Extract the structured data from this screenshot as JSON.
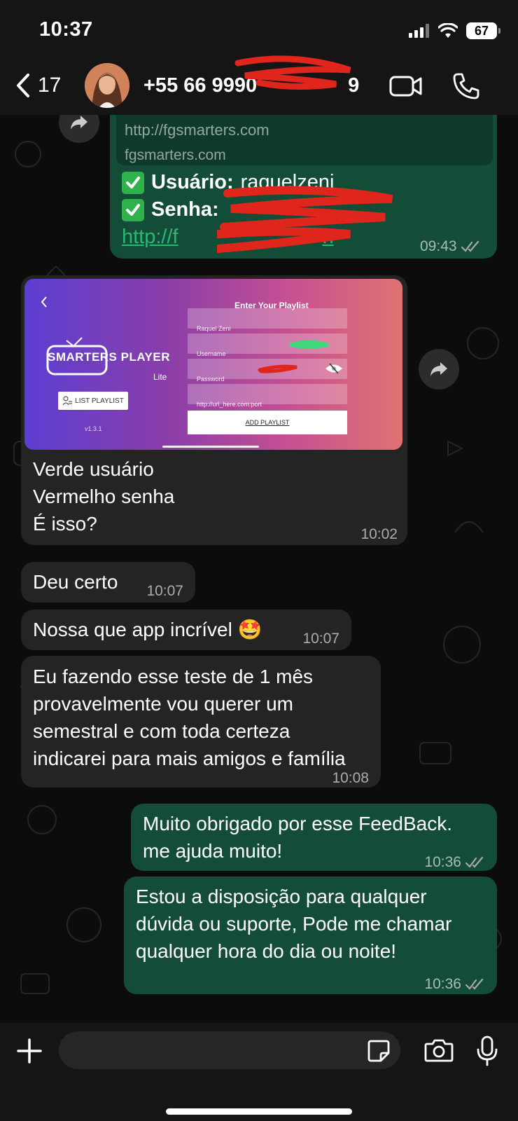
{
  "status_bar": {
    "time": "10:37",
    "battery": "67"
  },
  "header": {
    "back_count": "17",
    "contact_name": "+55 66 9990",
    "contact_suffix": "9"
  },
  "messages": {
    "m1": {
      "link_url": "http://fgsmarters.com",
      "link_domain": "fgsmarters.com",
      "user_label": "Usuário:",
      "user_value": "raquelzeni",
      "password_label": "Senha:",
      "link_text": "http://f",
      "link_tail": "n",
      "time": "09:43"
    },
    "m2": {
      "image": {
        "logo": "SMARTERS PLAYER",
        "logo_sub": "Lite",
        "list_button": "LIST PLAYLIST",
        "version": "v1.3.1",
        "title": "Enter Your Playlist",
        "field_name": "Raquel Zeni",
        "field_username": "Username",
        "field_password": "Password",
        "field_url": "http://url_here.com:port",
        "add_button": "ADD PLAYLIST"
      },
      "text": "Verde usuário\nVermelho senha\nÉ isso?",
      "time": "10:02"
    },
    "m3": {
      "text": "Deu certo",
      "time": "10:07"
    },
    "m4": {
      "text": "Nossa que app incrível",
      "emoji": "🤩",
      "time": "10:07"
    },
    "m5": {
      "text": "Eu fazendo esse teste de 1 mês\nprovavelmente vou querer um\nsemestral e com toda certeza\nindicarei para mais amigos e família",
      "time": "10:08"
    },
    "m6": {
      "text": "Muito obrigado por esse FeedBack.\nme ajuda muito!",
      "time": "10:36"
    },
    "m7": {
      "text": "Estou a disposição para qualquer\ndúvida ou suporte, Pode me chamar\nqualquer hora do dia ou noite!",
      "time": "10:36"
    }
  },
  "colors": {
    "outgoing_bubble": "#144d37",
    "incoming_bubble": "#242424",
    "link": "#29b872",
    "redaction": "#e0261c",
    "read_ticks": "#a8a8a8"
  },
  "icons": [
    "back-chevron-icon",
    "video-call-icon",
    "phone-call-icon",
    "forward-icon",
    "check-mark-icon",
    "double-check-icon",
    "plus-icon",
    "sticker-icon",
    "camera-icon",
    "microphone-icon",
    "signal-icon",
    "wifi-icon",
    "battery-icon"
  ]
}
